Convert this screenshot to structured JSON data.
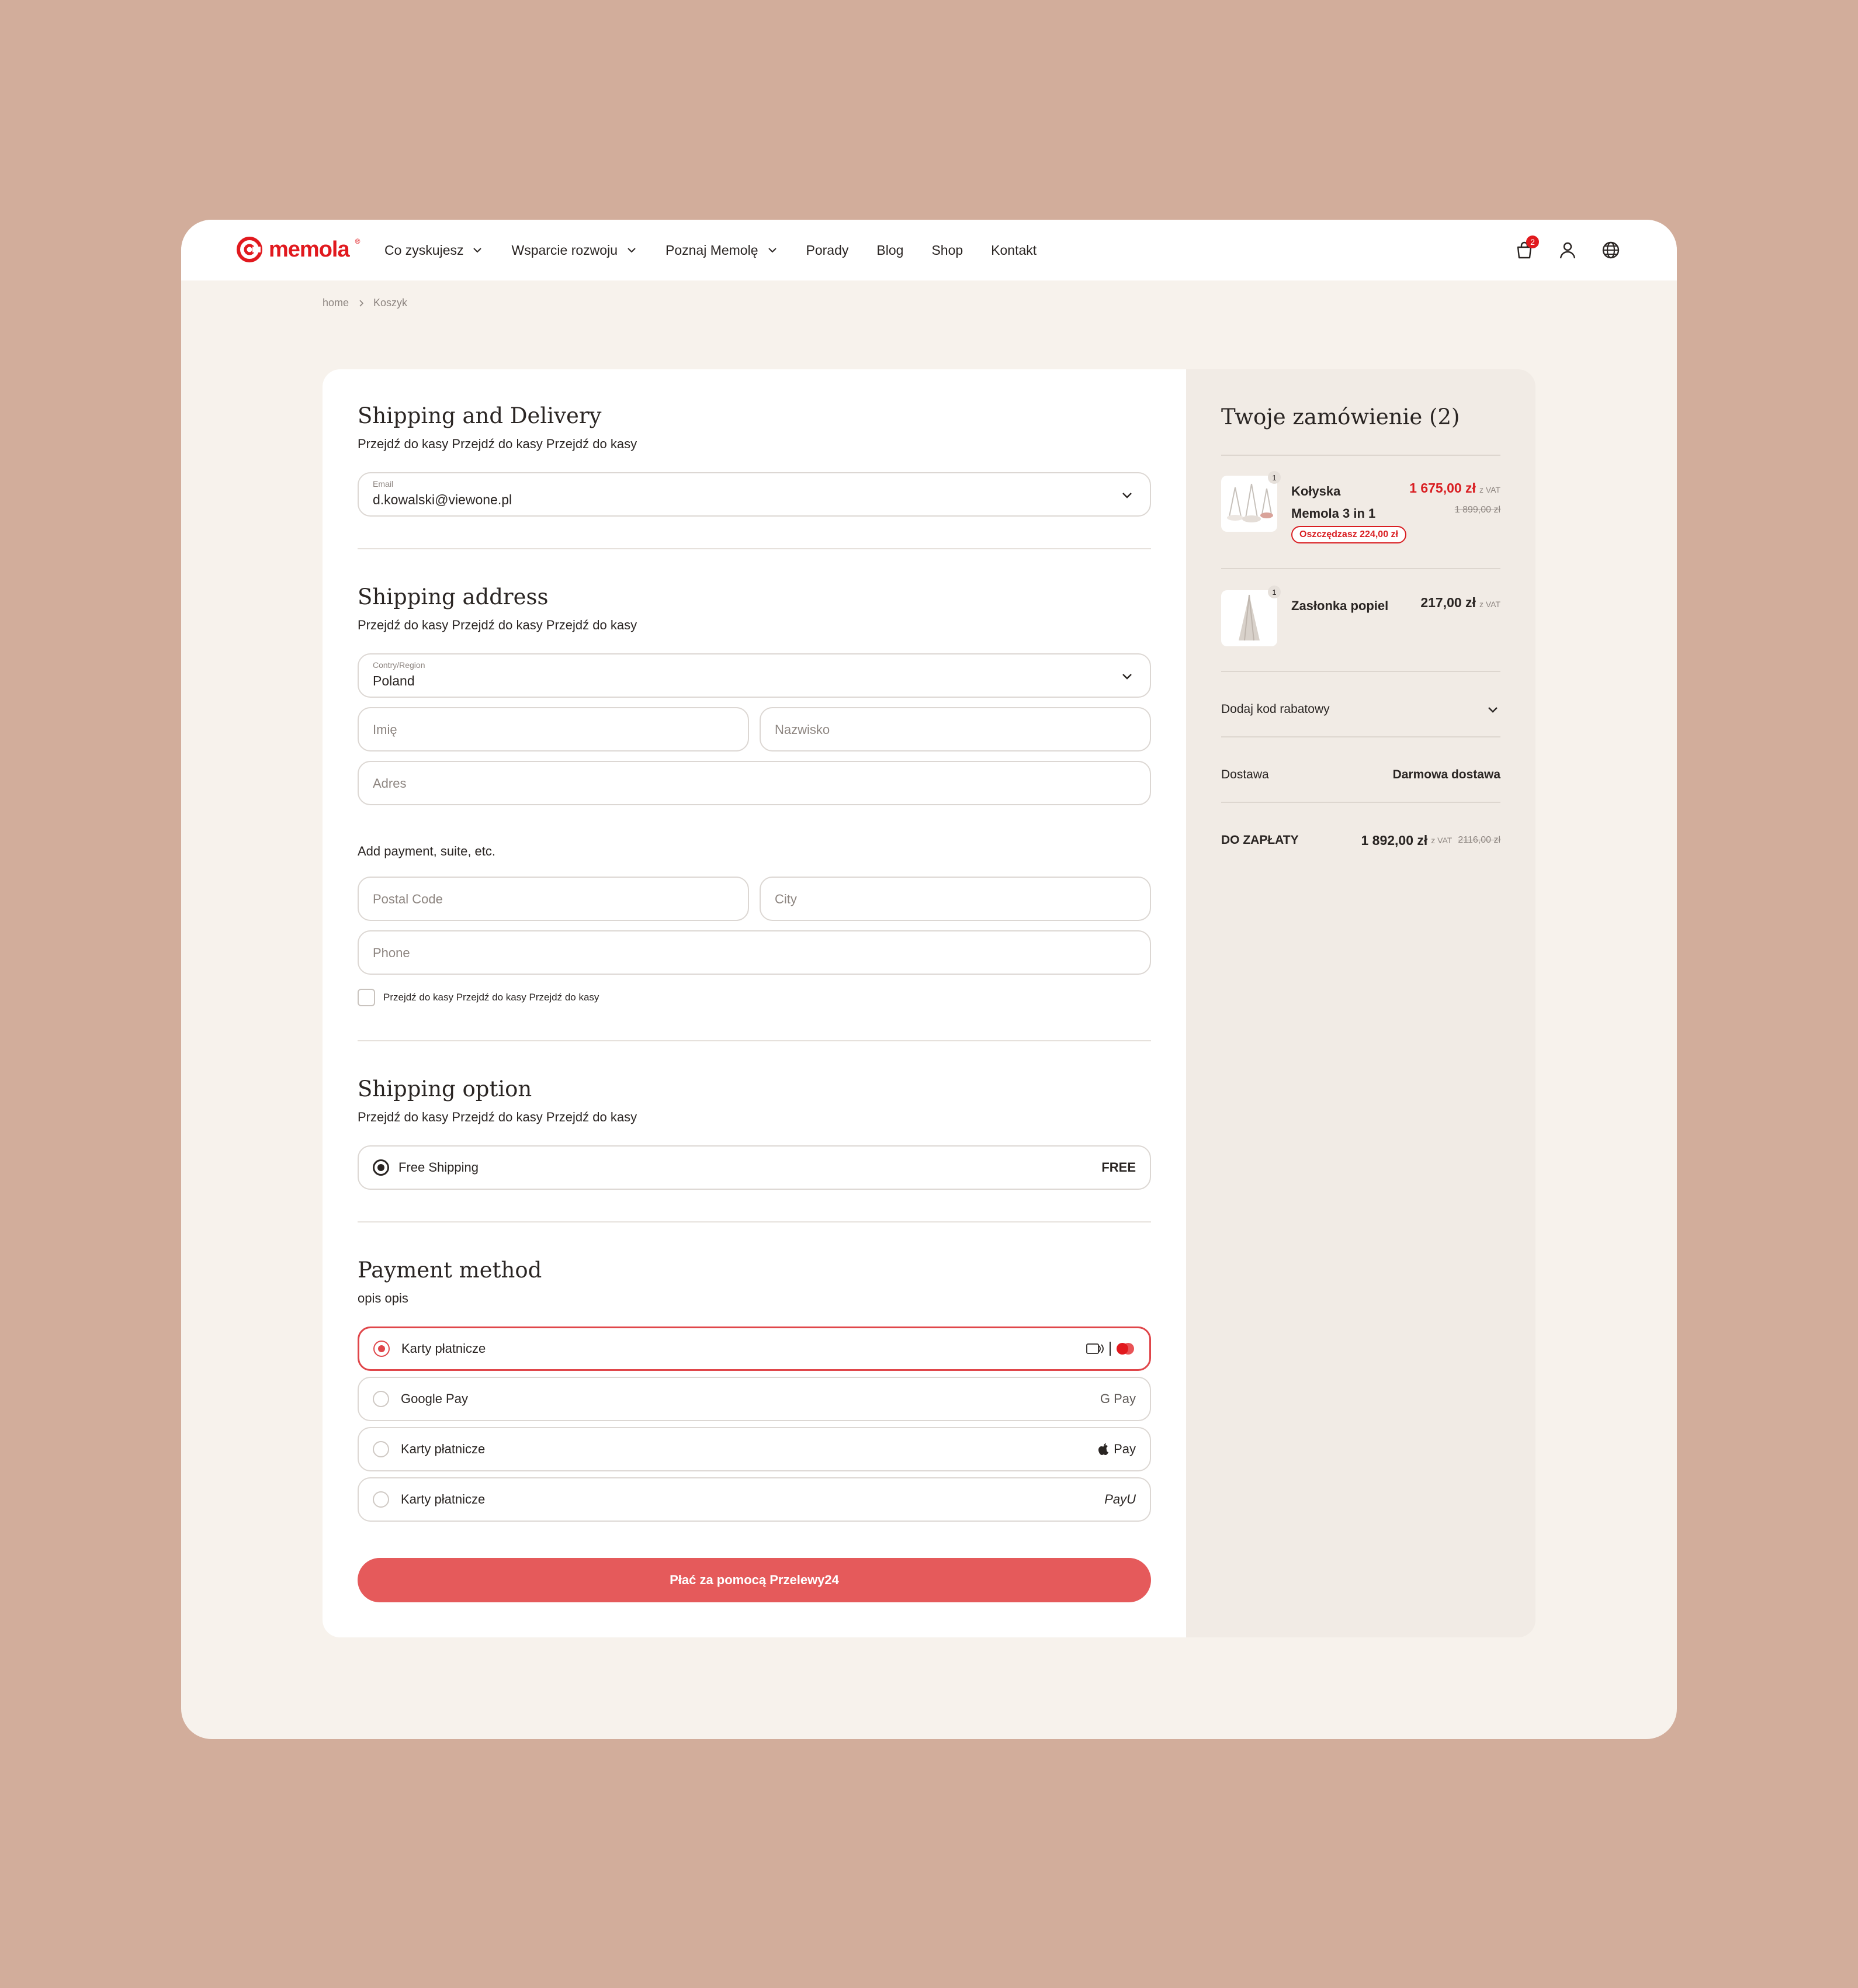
{
  "brand": {
    "name": "memola",
    "reg": "®",
    "color": "#e1191e"
  },
  "nav": {
    "items": [
      {
        "label": "Co zyskujesz",
        "dropdown": true
      },
      {
        "label": "Wsparcie rozwoju",
        "dropdown": true
      },
      {
        "label": "Poznaj Memolę",
        "dropdown": true
      },
      {
        "label": "Porady",
        "dropdown": false
      },
      {
        "label": "Blog",
        "dropdown": false
      },
      {
        "label": "Shop",
        "dropdown": false
      },
      {
        "label": "Kontakt",
        "dropdown": false
      }
    ],
    "cart_count": "2"
  },
  "breadcrumb": {
    "home": "home",
    "current": "Koszyk"
  },
  "shipping_delivery": {
    "title": "Shipping and Delivery",
    "subtitle": "Przejdź do kasy Przejdź do kasy Przejdź do kasy",
    "email_label": "Email",
    "email_value": "d.kowalski@viewone.pl"
  },
  "shipping_address": {
    "title": "Shipping address",
    "subtitle": "Przejdź do kasy Przejdź do kasy Przejdź do kasy",
    "country_label": "Contry/Region",
    "country_value": "Poland",
    "first_name_placeholder": "Imię",
    "last_name_placeholder": "Nazwisko",
    "address_placeholder": "Adres",
    "add_more_label": "Add payment, suite, etc.",
    "postal_placeholder": "Postal Code",
    "city_placeholder": "City",
    "phone_placeholder": "Phone",
    "checkbox_label": "Przejdź do kasy Przejdź do kasy Przejdź do kasy"
  },
  "shipping_option": {
    "title": "Shipping option",
    "subtitle": "Przejdź do kasy Przejdź do kasy Przejdź do kasy",
    "option_label": "Free Shipping",
    "option_price": "FREE"
  },
  "payment": {
    "title": "Payment method",
    "subtitle": "opis opis",
    "methods": [
      {
        "label": "Karty płatnicze",
        "icon": "cards-icon",
        "selected": true
      },
      {
        "label": "Google Pay",
        "icon_text": "G Pay",
        "selected": false
      },
      {
        "label": "Karty płatnicze",
        "icon_text": "Pay",
        "selected": false
      },
      {
        "label": "Karty płatnicze",
        "icon_text": "PayU",
        "selected": false
      }
    ],
    "pay_button": "Płać za pomocą Przelewy24",
    "accent": "#e55a5b"
  },
  "summary": {
    "title": "Twoje zamówienie (2)",
    "items": [
      {
        "name_line1": "Kołyska",
        "name_line2": "Memola 3 in 1",
        "price": "1 675,00 zł",
        "vat": "z VAT",
        "old_price": "1 899,00 zł",
        "savings": "Oszczędzasz 224,00 zł",
        "qty": "1"
      },
      {
        "name_line1": "Zasłonka popiel",
        "price": "217,00 zł",
        "vat": "z VAT",
        "qty": "1"
      }
    ],
    "discount_label": "Dodaj kod rabatowy",
    "delivery_label": "Dostawa",
    "delivery_value": "Darmowa dostawa",
    "total_label": "DO ZAPŁATY",
    "total_value": "1 892,00 zł",
    "total_vat": "z VAT",
    "total_old": "2116,00 zł"
  }
}
